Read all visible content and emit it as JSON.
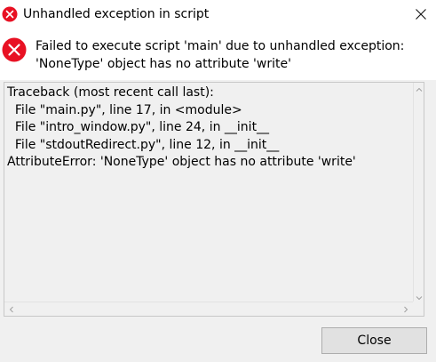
{
  "window": {
    "title": "Unhandled exception in script",
    "icon": "error-icon",
    "close_glyph": "✕"
  },
  "message": {
    "line1": "Failed to execute script 'main' due to unhandled exception:",
    "line2": "'NoneType' object has no attribute 'write'"
  },
  "traceback": {
    "lines": [
      "Traceback (most recent call last):",
      "  File \"main.py\", line 17, in <module>",
      "  File \"intro_window.py\", line 24, in __init__",
      "  File \"stdoutRedirect.py\", line 12, in __init__",
      "AttributeError: 'NoneType' object has no attribute 'write'"
    ]
  },
  "buttons": {
    "close_label": "Close"
  },
  "colors": {
    "error_red": "#e81123",
    "button_bg": "#e1e1e1",
    "dialog_bg": "#f0f0f0"
  }
}
